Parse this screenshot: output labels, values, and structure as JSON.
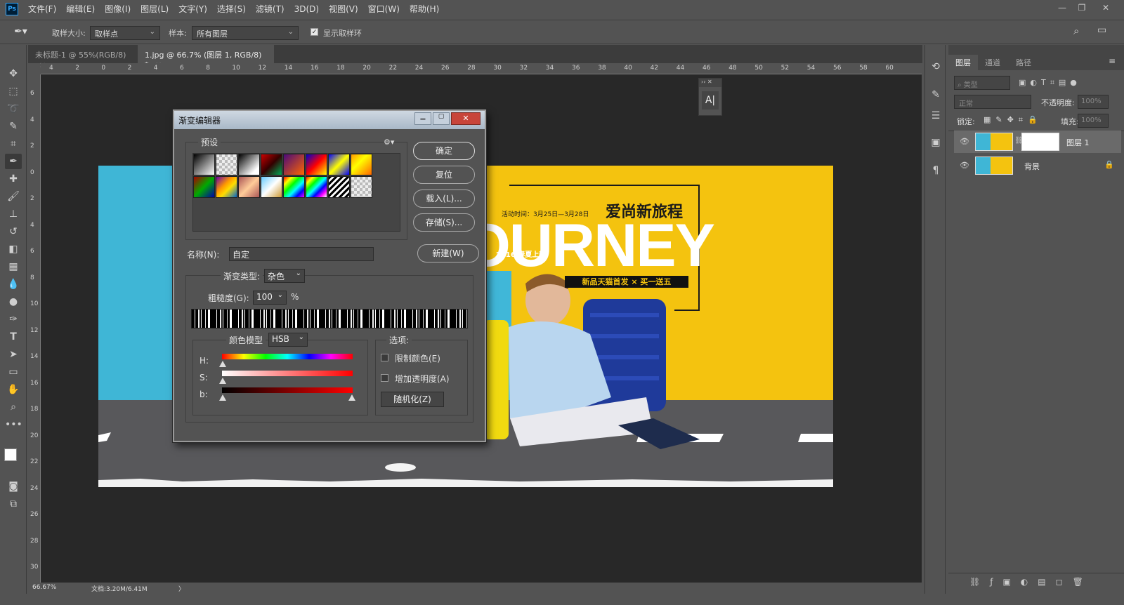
{
  "app": {
    "logo": "Ps",
    "menu": [
      "文件(F)",
      "编辑(E)",
      "图像(I)",
      "图层(L)",
      "文字(Y)",
      "选择(S)",
      "滤镜(T)",
      "3D(D)",
      "视图(V)",
      "窗口(W)",
      "帮助(H)"
    ],
    "window_controls": [
      "—",
      "❐",
      "✕"
    ]
  },
  "options_bar": {
    "sample_size_label": "取样大小:",
    "sample_size_value": "取样点",
    "sample_label": "样本:",
    "sample_value": "所有图层",
    "show_ring_label": "显示取样环",
    "show_ring_checked": true
  },
  "tabs": [
    {
      "label": "未标题-1 @ 55%(RGB/8)",
      "close": "×",
      "active": false
    },
    {
      "label": "1.jpg @ 66.7% (图层 1, RGB/8) *",
      "close": "×",
      "active": true
    }
  ],
  "ruler": {
    "top_ticks": [
      "4",
      "2",
      "0",
      "2",
      "4",
      "6",
      "8",
      "10",
      "12",
      "14",
      "16",
      "18",
      "20",
      "22",
      "24",
      "26",
      "28",
      "30",
      "32",
      "34",
      "36",
      "38",
      "40",
      "42",
      "44",
      "46",
      "48",
      "50",
      "52",
      "54",
      "56",
      "58",
      "60"
    ],
    "left_ticks": [
      "6",
      "4",
      "2",
      "0",
      "2",
      "4",
      "6",
      "8",
      "10",
      "12",
      "14",
      "16",
      "18",
      "20",
      "22",
      "24",
      "26",
      "28",
      "30"
    ]
  },
  "status": {
    "zoom": "66.67%",
    "doc": "文档:3.20M/6.41M",
    "arrow": "〉"
  },
  "artwork": {
    "headline_cn": "爱尚新旅程",
    "event_time": "活动时间：3月25日—3月28日",
    "big_text": "OURNEY",
    "year_tag": "2016 春夏上新",
    "banner_text": "新品天猫首发 × 买一送五"
  },
  "char_panel": {
    "icon_label": "A|"
  },
  "layers_panel": {
    "tabs": [
      "图层",
      "通道",
      "路径"
    ],
    "filter_label": "类型",
    "blend_mode": "正常",
    "opacity_label": "不透明度:",
    "opacity_value": "100%",
    "lock_label": "锁定:",
    "fill_label": "填充:",
    "fill_value": "100%",
    "layers": [
      {
        "name": "图层 1",
        "selected": true,
        "has_mask": true
      },
      {
        "name": "背景",
        "selected": false,
        "locked": true
      }
    ],
    "footer_icons": [
      "link-icon",
      "fx-icon",
      "mask-icon",
      "adjustment-icon",
      "folder-icon",
      "new-layer-icon",
      "trash-icon"
    ]
  },
  "gradient_editor": {
    "title": "渐变编辑器",
    "presets_label": "预设",
    "buttons": {
      "ok": "确定",
      "reset": "复位",
      "load": "载入(L)...",
      "save": "存储(S)...",
      "new": "新建(W)"
    },
    "name_label": "名称(N):",
    "name_value": "自定",
    "type_label": "渐变类型:",
    "type_value": "杂色",
    "roughness_label": "粗糙度(G):",
    "roughness_value": "100",
    "roughness_unit": "%",
    "color_model_label": "颜色模型",
    "color_model_value": "HSB",
    "channels": [
      "H:",
      "S:",
      "b:"
    ],
    "options_label": "选项:",
    "restrict_colors": "限制颜色(E)",
    "add_transparency": "增加透明度(A)",
    "randomize": "随机化(Z)"
  }
}
